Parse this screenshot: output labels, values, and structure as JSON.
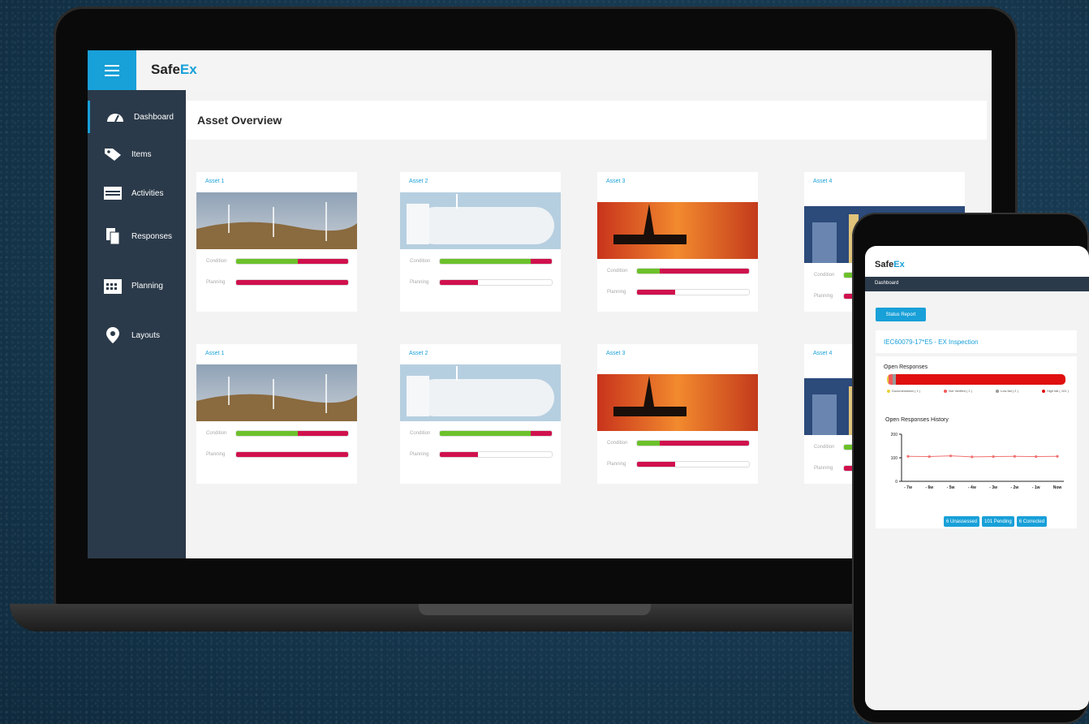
{
  "app": {
    "logo_text": "Safe",
    "logo_accent": "Ex",
    "accent_color": "#18a0d8",
    "sidebar_color": "#2b3a4a"
  },
  "sidebar": {
    "items": [
      {
        "label": "Dashboard",
        "icon": "dashboard-gauge-icon",
        "active": true
      },
      {
        "label": "Items",
        "icon": "tag-icon"
      },
      {
        "label": "Activities",
        "icon": "calendar-card-icon"
      },
      {
        "label": "Responses",
        "icon": "documents-icon"
      },
      {
        "label": "Planning",
        "icon": "calendar-grid-icon"
      },
      {
        "label": "Layouts",
        "icon": "map-pin-icon"
      }
    ]
  },
  "main": {
    "title": "Asset Overview",
    "condition_label": "Condition",
    "planning_label": "Planning",
    "cards": [
      {
        "title": "Asset 1",
        "image": "wind-turbines",
        "condition_green": 0.55,
        "planning_fill": 1.0
      },
      {
        "title": "Asset 2",
        "image": "gas-tank",
        "condition_green": 0.81,
        "planning_fill": 0.34
      },
      {
        "title": "Asset 3",
        "image": "oil-rig-sunset",
        "condition_green": 0.2,
        "planning_fill": 0.34
      },
      {
        "title": "Asset 4",
        "image": "refinery-night",
        "condition_green": 0.55,
        "planning_fill": 1.0
      },
      {
        "title": "Asset 1",
        "image": "wind-turbines",
        "condition_green": 0.55,
        "planning_fill": 1.0
      },
      {
        "title": "Asset 2",
        "image": "gas-tank",
        "condition_green": 0.81,
        "planning_fill": 0.34
      },
      {
        "title": "Asset 3",
        "image": "oil-rig-sunset",
        "condition_green": 0.2,
        "planning_fill": 0.34
      },
      {
        "title": "Asset 4",
        "image": "refinery-night",
        "condition_green": 0.55,
        "planning_fill": 1.0
      }
    ]
  },
  "mobile": {
    "logo_text": "Safe",
    "logo_accent": "Ex",
    "nav_label": "Dashboard",
    "status_button": "Status Report",
    "inspection_title": "IEC60079-17*E5 - EX Inspection",
    "open_responses_title": "Open Responses",
    "legend": [
      {
        "label": "Documentation ( 1 )",
        "color": "#e8d23a"
      },
      {
        "label": "Not Verified ( 2 )",
        "color": "#f25b5b"
      },
      {
        "label": "Low fail ( 2 )",
        "color": "#9a9a9a"
      },
      {
        "label": "High fail ( 101 )",
        "color": "#e01010"
      }
    ],
    "history_title": "Open Responses History",
    "pills": [
      "6 Unassessed",
      "101 Pending",
      "6 Corrected"
    ]
  },
  "chart_data": {
    "type": "line",
    "title": "Open Responses History",
    "categories": [
      "- 7w",
      "- 6w",
      "- 5w",
      "- 4w",
      "- 3w",
      "- 2w",
      "- 1w",
      "Now"
    ],
    "series": [
      {
        "values": [
          106,
          105,
          108,
          104,
          105,
          106,
          105,
          106
        ],
        "color": "#f07070"
      }
    ],
    "ylim": [
      0,
      200
    ],
    "yticks": [
      "0",
      "100",
      "200"
    ]
  }
}
